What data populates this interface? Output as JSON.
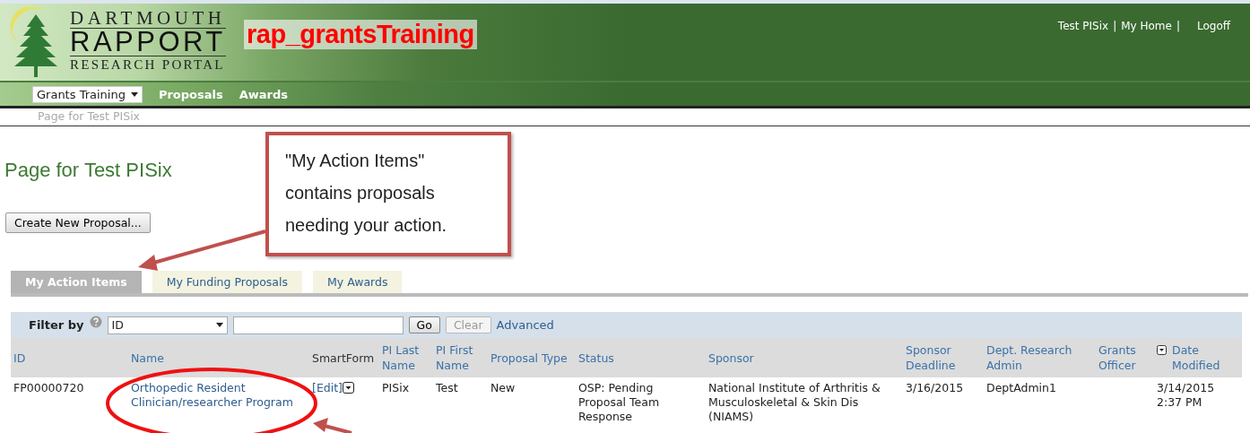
{
  "header": {
    "logo": {
      "line1": "DARTMOUTH",
      "line2": "RAPPORT",
      "line3": "RESEARCH PORTAL"
    },
    "overlay_text": "rap_grantsTraining",
    "user_links": [
      {
        "kind": "link",
        "text": "Test PISix"
      },
      {
        "kind": "separator",
        "text": "|"
      },
      {
        "kind": "link",
        "text": "My Home"
      },
      {
        "kind": "separator",
        "text": "|"
      },
      {
        "kind": "link",
        "text": "Logoff"
      }
    ]
  },
  "nav": {
    "dropdown": "Grants Training",
    "links": [
      "Proposals",
      "Awards"
    ]
  },
  "breadcrumb": "Page for Test PISix",
  "page_title": "Page for Test PISix",
  "create_button": "Create New Proposal...",
  "tabs": [
    {
      "label": "My Action Items",
      "selected": true
    },
    {
      "label": "My Funding Proposals",
      "selected": false
    },
    {
      "label": "My Awards",
      "selected": false
    }
  ],
  "filter": {
    "label": "Filter by",
    "field": "ID",
    "go": "Go",
    "clear": {
      "label": "Clear",
      "disabled": true
    },
    "advanced": "Advanced"
  },
  "table": {
    "columns": [
      {
        "label": "ID",
        "link": true
      },
      {
        "label": "Name",
        "link": true
      },
      {
        "label": "SmartForm",
        "link": false
      },
      {
        "label": "PI Last Name",
        "link": true
      },
      {
        "label": "PI First Name",
        "link": true
      },
      {
        "label": "Proposal Type",
        "link": true
      },
      {
        "label": "Status",
        "link": true
      },
      {
        "label": "Sponsor",
        "link": true
      },
      {
        "label": "Sponsor Deadline",
        "link": true
      },
      {
        "label": "Dept. Research Admin",
        "link": true
      },
      {
        "label": "Grants Officer",
        "link": true
      },
      {
        "label": "Date Modified",
        "link": true,
        "sorted": true
      }
    ],
    "rows": [
      {
        "id": "FP00000720",
        "name": "Orthopedic Resident Clinician/researcher Program",
        "smartform": "[Edit]",
        "pi_last": "PISix",
        "pi_first": "Test",
        "type": "New",
        "status": "OSP: Pending Proposal Team Response",
        "sponsor": "National Institute of Arthritis & Musculoskeletal & Skin Dis (NIAMS)",
        "deadline": "3/16/2015",
        "admin": "DeptAdmin1",
        "officer": "",
        "modified": "3/14/2015 2:37 PM"
      }
    ]
  },
  "annotation": {
    "callout": "\"My Action Items\"\ncontains proposals\nneeding your action."
  }
}
